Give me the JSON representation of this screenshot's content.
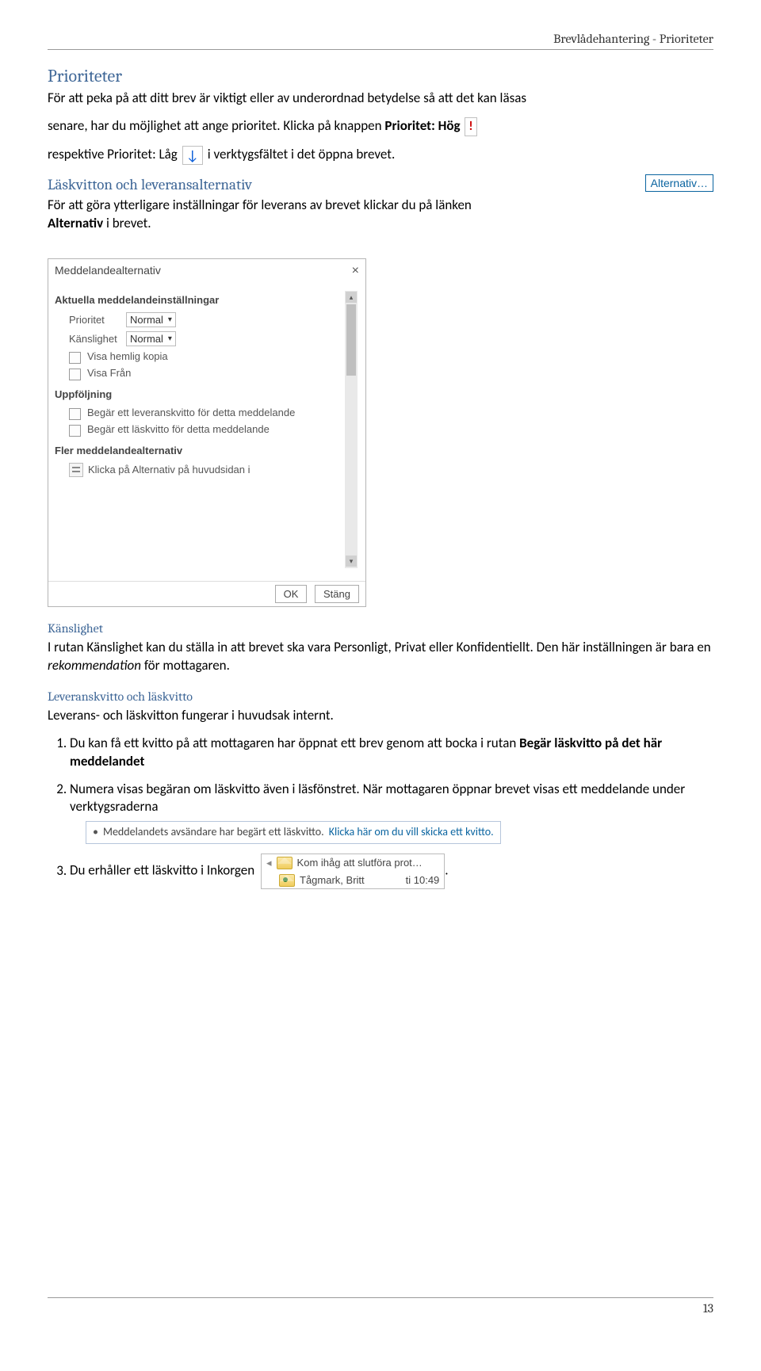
{
  "header": "Brevlådehantering - Prioriteter",
  "section_title": "Prioriteter",
  "p1_a": "För att peka på att ditt brev är viktigt eller av underordnad betydelse så att det kan läsas",
  "p1_b_pre": "senare, har du möjlighet att ange prioritet. Klicka på knappen ",
  "p1_b_bold": "Prioritet: Hög",
  "p1_c_pre": "respektive Prioritet: Låg",
  "p1_c_post": " i verktygsfältet i det öppna brevet.",
  "sub1_title": "Läskvitton och leveransalternativ",
  "sub1_text_a": "För att göra ytterligare inställningar för leverans av brevet klickar du på länken ",
  "sub1_text_bold": "Alternativ",
  "sub1_text_b": " i brevet.",
  "alt_link": "Alternativ…",
  "dialog": {
    "title": "Meddelandealternativ",
    "sect1": "Aktuella meddelandeinställningar",
    "prio_label": "Prioritet",
    "prio_value": "Normal",
    "sens_label": "Känslighet",
    "sens_value": "Normal",
    "chk_bcc": "Visa hemlig kopia",
    "chk_from": "Visa Från",
    "sect2": "Uppföljning",
    "chk_delivery": "Begär ett leveranskvitto för detta meddelande",
    "chk_read": "Begär ett läskvitto för detta meddelande",
    "sect3": "Fler meddelandealternativ",
    "more_text": "Klicka på Alternativ på huvudsidan i",
    "btn_ok": "OK",
    "btn_close": "Stäng"
  },
  "sens_title": "Känslighet",
  "sens_text_a": "I rutan Känslighet kan du ställa in att brevet ska vara Personligt, Privat eller Konfidentiellt. Den här inställningen är bara en ",
  "sens_text_em": "rekommendation",
  "sens_text_b": " för mottagaren.",
  "lk_title": "Leveranskvitto och läskvitto",
  "lk_intro": "Leverans- och läskvitton fungerar i huvudsak internt.",
  "list": {
    "i1_a": "Du kan få ett kvitto på att mottagaren har öppnat ett brev genom att bocka i rutan ",
    "i1_b": "Begär läskvitto på det här meddelandet",
    "i2": "Numera visas begäran om läskvitto även i läsfönstret. När mottagaren öppnar brevet visas ett meddelande under verktygsraderna",
    "infobar_a": "Meddelandets avsändare har begärt ett läskvitto.",
    "infobar_link": "Klicka här om du vill skicka ett kvitto.",
    "i3": "Du erhåller ett läskvitto i Inkorgen",
    "inbox_subject": "Kom ihåg att slutföra prot…",
    "inbox_sender": "Tågmark, Britt",
    "inbox_time": "ti 10:49"
  },
  "footer_page": "13"
}
